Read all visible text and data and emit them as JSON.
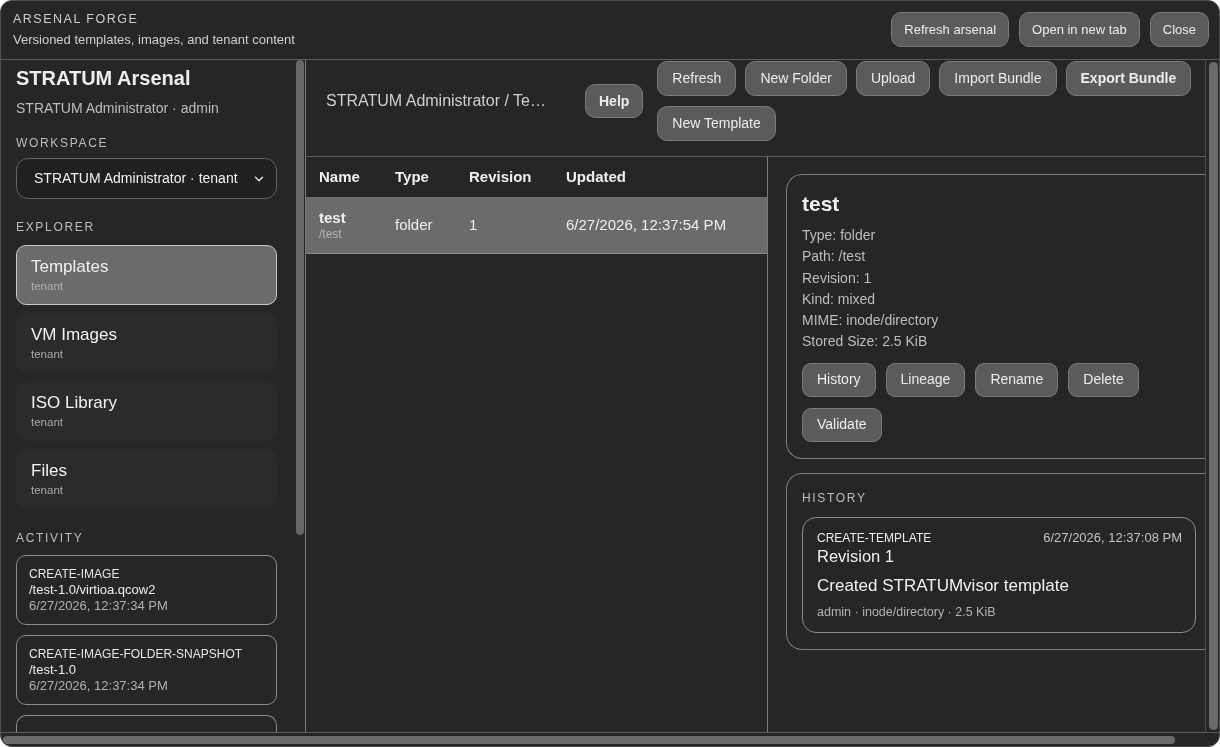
{
  "window": {
    "title": "ARSENAL FORGE",
    "subtitle": "Versioned templates, images, and tenant content",
    "buttons": [
      "Refresh arsenal",
      "Open in new tab",
      "Close"
    ]
  },
  "sidebar": {
    "title": "STRATUM Arsenal",
    "user": "STRATUM Administrator · admin",
    "workspace_label": "WORKSPACE",
    "workspace_select": {
      "value": "STRATUM Administrator · tenant"
    },
    "explorer_label": "EXPLORER",
    "explorer_items": [
      {
        "label": "Templates",
        "scope": "tenant",
        "selected": true
      },
      {
        "label": "VM Images",
        "scope": "tenant",
        "selected": false
      },
      {
        "label": "ISO Library",
        "scope": "tenant",
        "selected": false
      },
      {
        "label": "Files",
        "scope": "tenant",
        "selected": false
      }
    ],
    "activity_label": "ACTIVITY",
    "activity": [
      {
        "kind": "entry",
        "action": "CREATE-IMAGE",
        "path": "/test-1.0/virtioa.qcow2",
        "time": "6/27/2026, 12:37:34 PM"
      },
      {
        "kind": "entry",
        "action": "CREATE-IMAGE-FOLDER-SNAPSHOT",
        "path": "/test-1.0",
        "time": "6/27/2026, 12:37:34 PM"
      },
      {
        "kind": "partial"
      }
    ]
  },
  "toolbar": {
    "breadcrumb": "STRATUM Administrator / Te…",
    "help_button": {
      "label": "Help",
      "kind": "primary"
    },
    "buttons": [
      {
        "label": "Refresh",
        "kind": "default"
      },
      {
        "label": "New Folder",
        "kind": "default"
      },
      {
        "label": "Upload",
        "kind": "default"
      },
      {
        "label": "Import Bundle",
        "kind": "default"
      },
      {
        "label": "Export Bundle",
        "kind": "primary"
      },
      {
        "label": "New Template",
        "kind": "default"
      }
    ]
  },
  "table": {
    "columns": [
      "Name",
      "Type",
      "Revision",
      "Updated"
    ],
    "rows": [
      {
        "name": "test",
        "path": "/test",
        "type": "folder",
        "revision": "1",
        "updated": "6/27/2026, 12:37:54 PM",
        "selected": true
      }
    ]
  },
  "details": {
    "title": "test",
    "fields": [
      "Type: folder",
      "Path: /test",
      "Revision: 1",
      "Kind: mixed",
      "MIME: inode/directory",
      "Stored Size: 2.5 KiB"
    ],
    "actions": [
      "History",
      "Lineage",
      "Rename",
      "Delete",
      "Validate"
    ]
  },
  "history": {
    "label": "HISTORY",
    "entries": [
      {
        "action": "CREATE-TEMPLATE",
        "time": "6/27/2026, 12:37:08 PM",
        "revision": "Revision 1",
        "message": "Created STRATUMvisor template",
        "meta": "admin · inode/directory · 2.5 KiB"
      }
    ]
  }
}
